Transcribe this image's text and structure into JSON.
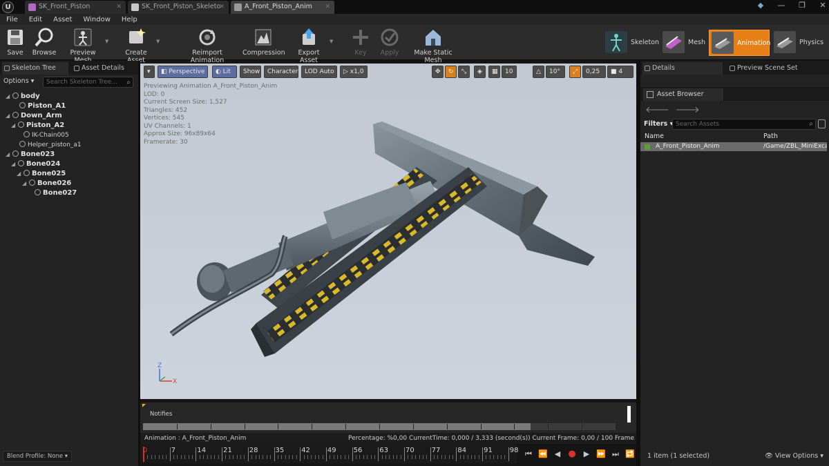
{
  "titlebar": {
    "tabs": [
      {
        "label": "SK_Front_Piston",
        "active": false,
        "color": "#b06ac0"
      },
      {
        "label": "SK_Front_Piston_Skeleto",
        "active": false,
        "color": "#c8c8c8"
      },
      {
        "label": "A_Front_Piston_Anim",
        "active": true,
        "color": "#9a9a9a"
      }
    ],
    "window_controls": [
      "—",
      "❐",
      "✕"
    ]
  },
  "menu": [
    "File",
    "Edit",
    "Asset",
    "Window",
    "Help"
  ],
  "toolbar": {
    "buttons": [
      {
        "label": "Save",
        "icon": "save-icon",
        "enabled": true
      },
      {
        "label": "Browse",
        "icon": "browse-icon",
        "enabled": true
      },
      {
        "label": "Preview Mesh",
        "icon": "preview-mesh-icon",
        "enabled": true
      },
      {
        "label": "Create Asset",
        "icon": "create-asset-icon",
        "enabled": true
      },
      {
        "label": "Reimport Animation",
        "icon": "reimport-icon",
        "enabled": true
      },
      {
        "label": "Compression",
        "icon": "compression-icon",
        "enabled": true
      },
      {
        "label": "Export Asset",
        "icon": "export-icon",
        "enabled": true
      },
      {
        "label": "Key",
        "icon": "key-icon",
        "enabled": false
      },
      {
        "label": "Apply",
        "icon": "apply-icon",
        "enabled": false
      },
      {
        "label": "Make Static Mesh",
        "icon": "static-mesh-icon",
        "enabled": true
      }
    ],
    "modes": [
      {
        "label": "Skeleton",
        "active": false
      },
      {
        "label": "Mesh",
        "active": false
      },
      {
        "label": "Animation",
        "active": true
      },
      {
        "label": "Physics",
        "active": false
      }
    ]
  },
  "left_panel": {
    "tabs": [
      "Skeleton Tree",
      "Asset Details"
    ],
    "options_label": "Options ▾",
    "search_placeholder": "Search Skeleton Tree...",
    "bones": [
      {
        "name": "body",
        "expanded": true,
        "bold": true
      },
      {
        "name": "Piston_A1",
        "expanded": false,
        "bold": true
      },
      {
        "name": "Down_Arm",
        "expanded": true,
        "bold": true
      },
      {
        "name": "Piston_A2",
        "expanded": true,
        "bold": true
      },
      {
        "name": "IK-Chain005",
        "expanded": false,
        "bold": false
      },
      {
        "name": "Helper_piston_a1",
        "expanded": false,
        "bold": false
      },
      {
        "name": "Bone023",
        "expanded": true,
        "bold": true
      },
      {
        "name": "Bone024",
        "expanded": true,
        "bold": true
      },
      {
        "name": "Bone025",
        "expanded": true,
        "bold": true
      },
      {
        "name": "Bone026",
        "expanded": true,
        "bold": true
      },
      {
        "name": "Bone027",
        "expanded": false,
        "bold": true
      }
    ],
    "blend_profile": "Blend Profile: None ▾"
  },
  "viewport": {
    "toolbar": {
      "menu_arrow": "▾",
      "perspective": "Perspective",
      "lit": "Lit",
      "show": "Show",
      "character": "Character",
      "lod": "LOD Auto",
      "speed": "x1,0",
      "grid_snap": "10",
      "rotation_snap": "10°",
      "scale_snap": "0,25",
      "camera_speed": "4"
    },
    "info": [
      "Previewing Animation A_Front_Piston_Anim",
      "LOD: 0",
      "Current Screen Size: 1,527",
      "Triangles: 452",
      "Vertices: 545",
      "UV Channels: 1",
      "Approx Size: 96x89x64",
      "Framerate: 30"
    ],
    "axis": {
      "z": "Z",
      "x": "X"
    },
    "background_color": "#c4cbd6"
  },
  "notifies": {
    "label": "Notifies",
    "fill_fraction": 0.82
  },
  "animation_status": {
    "animation": "Animation : A_Front_Piston_Anim",
    "progress": "Percentage: %0,00 CurrentTime: 0,000 / 3,333 (second(s)) Current Frame: 0,00 / 100 Frame"
  },
  "timeline": {
    "current": "0",
    "labels": [
      "7",
      "14",
      "21",
      "28",
      "35",
      "42",
      "49",
      "56",
      "63",
      "70",
      "77",
      "84",
      "91",
      "98"
    ]
  },
  "transport": [
    "⏮",
    "⏪",
    "◀",
    "●",
    "▶",
    "⏩",
    "⏭",
    "🔁"
  ],
  "right_panel": {
    "tabs": [
      "Details",
      "Preview Scene Set"
    ],
    "asset_browser_tab": "Asset Browser",
    "nav": [
      "🡐",
      "🡒"
    ],
    "filters_label": "Filters ▾",
    "search_placeholder": "Search Assets",
    "columns": {
      "name": "Name",
      "path": "Path"
    },
    "assets": [
      {
        "name": "A_Front_Piston_Anim",
        "path": "/Game/ZBL_MiniExcavator"
      }
    ],
    "footer_count": "1 item (1 selected)",
    "view_options": "👁 View Options ▾"
  }
}
